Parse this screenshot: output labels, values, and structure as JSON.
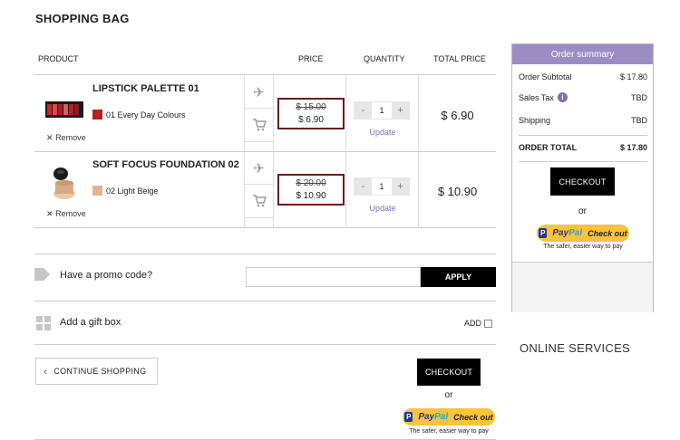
{
  "page_title": "SHOPPING BAG",
  "columns": {
    "product": "PRODUCT",
    "price": "PRICE",
    "quantity": "QUANTITY",
    "total": "TOTAL PRICE"
  },
  "items": [
    {
      "name": "LIPSTICK PALETTE 01",
      "shade": "01 Every Day Colours",
      "shade_color": "#b3231d",
      "old_price": "$ 15.00",
      "price": "$ 6.90",
      "qty": "1",
      "update": "Update",
      "total": "$ 6.90",
      "remove": "Remove",
      "remove_icon": "close-icon",
      "icons": [
        "airplane-icon",
        "cart-icon"
      ]
    },
    {
      "name": "SOFT FOCUS FOUNDATION 02",
      "shade": "02 Light Beige",
      "shade_color": "#e2b58f",
      "old_price": "$ 20.00",
      "price": "$ 10.90",
      "qty": "1",
      "update": "Update",
      "total": "$ 10.90",
      "remove": "Remove",
      "remove_icon": "close-icon",
      "icons": [
        "airplane-icon",
        "cart-icon"
      ]
    }
  ],
  "qty_minus": "-",
  "qty_plus": "+",
  "promo": {
    "label": "Have a promo code?",
    "placeholder": "",
    "apply": "APPLY",
    "icon": "tag-icon"
  },
  "gift": {
    "label": "Add a gift box",
    "add": "ADD",
    "icon": "gift-icon",
    "checked": false
  },
  "continue_shopping": "CONTINUE SHOPPING",
  "checkout": "CHECKOUT",
  "or": "or",
  "paypal": {
    "p": "P",
    "pay": "Pay",
    "pal": "Pal",
    "check_out": "Check out",
    "tagline": "The safer, easier way to pay"
  },
  "summary": {
    "title": "Order summary",
    "subtotal_label": "Order Subtotal",
    "subtotal": "$ 17.80",
    "tax_label": "Sales Tax",
    "tax": "TBD",
    "shipping_label": "Shipping",
    "shipping": "TBD",
    "total_label": "ORDER TOTAL",
    "total": "$ 17.80"
  },
  "online_services": "ONLINE SERVICES",
  "colors": {
    "accent": "#9b8cc3",
    "link": "#7f6fb6",
    "price_border": "#6b1a1a",
    "paypal": "#fdc33a"
  }
}
